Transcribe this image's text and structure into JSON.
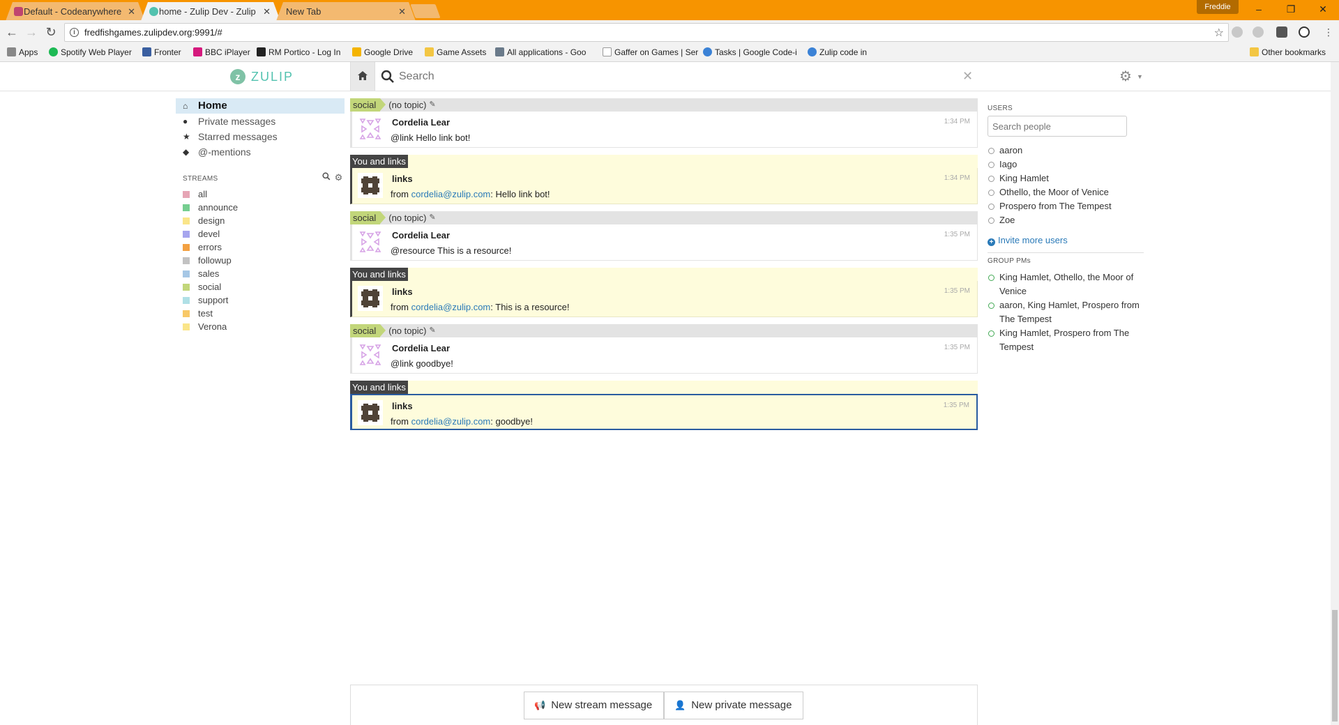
{
  "browser": {
    "tabs": [
      {
        "title": "Default - Codeanywhere",
        "close": "✕",
        "favicon_color": "#c0456f"
      },
      {
        "title": "home - Zulip Dev - Zulip",
        "close": "✕",
        "favicon_color": "#52c2af"
      },
      {
        "title": "New Tab",
        "close": "✕"
      }
    ],
    "profile": "Freddie",
    "url": "fredfishgames.zulipdev.org:9991/#",
    "bookmarks": [
      {
        "label": "Apps"
      },
      {
        "label": "Spotify Web Player"
      },
      {
        "label": "Fronter"
      },
      {
        "label": "BBC iPlayer"
      },
      {
        "label": "RM Portico - Log In"
      },
      {
        "label": "Google Drive"
      },
      {
        "label": "Game Assets"
      },
      {
        "label": "All applications - Goo"
      },
      {
        "label": "Gaffer on Games | Ser"
      },
      {
        "label": "Tasks | Google Code-i"
      },
      {
        "label": "Zulip code in"
      }
    ],
    "other_bookmarks": "Other bookmarks"
  },
  "header": {
    "logo_text": "ZULIP",
    "search_placeholder": "Search"
  },
  "left_sidebar": {
    "nav": [
      {
        "label": "Home",
        "icon": "home-icon"
      },
      {
        "label": "Private messages",
        "icon": "user-icon"
      },
      {
        "label": "Starred messages",
        "icon": "star-icon"
      },
      {
        "label": "@-mentions",
        "icon": "tag-icon"
      }
    ],
    "streams_header": "STREAMS",
    "streams": [
      {
        "name": "all",
        "color": "#e6a5b5"
      },
      {
        "name": "announce",
        "color": "#76ce90"
      },
      {
        "name": "design",
        "color": "#fae589"
      },
      {
        "name": "devel",
        "color": "#a6a5ee"
      },
      {
        "name": "errors",
        "color": "#f3a142"
      },
      {
        "name": "followup",
        "color": "#c2c2c2"
      },
      {
        "name": "sales",
        "color": "#a6c7e5"
      },
      {
        "name": "social",
        "color": "#c2d67a"
      },
      {
        "name": "support",
        "color": "#b0e0e6"
      },
      {
        "name": "test",
        "color": "#f8c867"
      },
      {
        "name": "Verona",
        "color": "#fae589"
      }
    ]
  },
  "messages": [
    {
      "kind": "stream",
      "stream": "social",
      "topic": "(no topic)",
      "sender": "Cordelia Lear",
      "time": "1:34 PM",
      "body": "@link Hello link bot!"
    },
    {
      "kind": "pm",
      "recipient": "You and links",
      "sender": "links",
      "time": "1:34 PM",
      "from_label": "from",
      "email": "cordelia@zulip.com",
      "text": ": Hello link bot!"
    },
    {
      "kind": "stream",
      "stream": "social",
      "topic": "(no topic)",
      "sender": "Cordelia Lear",
      "time": "1:35 PM",
      "body": "@resource This is a resource!"
    },
    {
      "kind": "pm",
      "recipient": "You and links",
      "sender": "links",
      "time": "1:35 PM",
      "from_label": "from",
      "email": "cordelia@zulip.com",
      "text": ": This is a resource!"
    },
    {
      "kind": "stream",
      "stream": "social",
      "topic": "(no topic)",
      "sender": "Cordelia Lear",
      "time": "1:35 PM",
      "body": "@link goodbye!"
    },
    {
      "kind": "pm",
      "recipient": "You and links",
      "sender": "links",
      "time": "1:35 PM",
      "from_label": "from",
      "email": "cordelia@zulip.com",
      "text": ": goodbye!"
    }
  ],
  "compose": {
    "new_stream": "New stream message",
    "new_private": "New private message"
  },
  "right_sidebar": {
    "users_header": "USERS",
    "search_placeholder": "Search people",
    "users": [
      "aaron",
      "Iago",
      "King Hamlet",
      "Othello, the Moor of Venice",
      "Prospero from The Tempest",
      "Zoe"
    ],
    "invite": "Invite more users",
    "group_pms_header": "GROUP PMs",
    "group_pms": [
      "King Hamlet, Othello, the Moor of Venice",
      "aaron, King Hamlet, Prospero from The Tempest",
      "King Hamlet, Prospero from The Tempest"
    ]
  }
}
